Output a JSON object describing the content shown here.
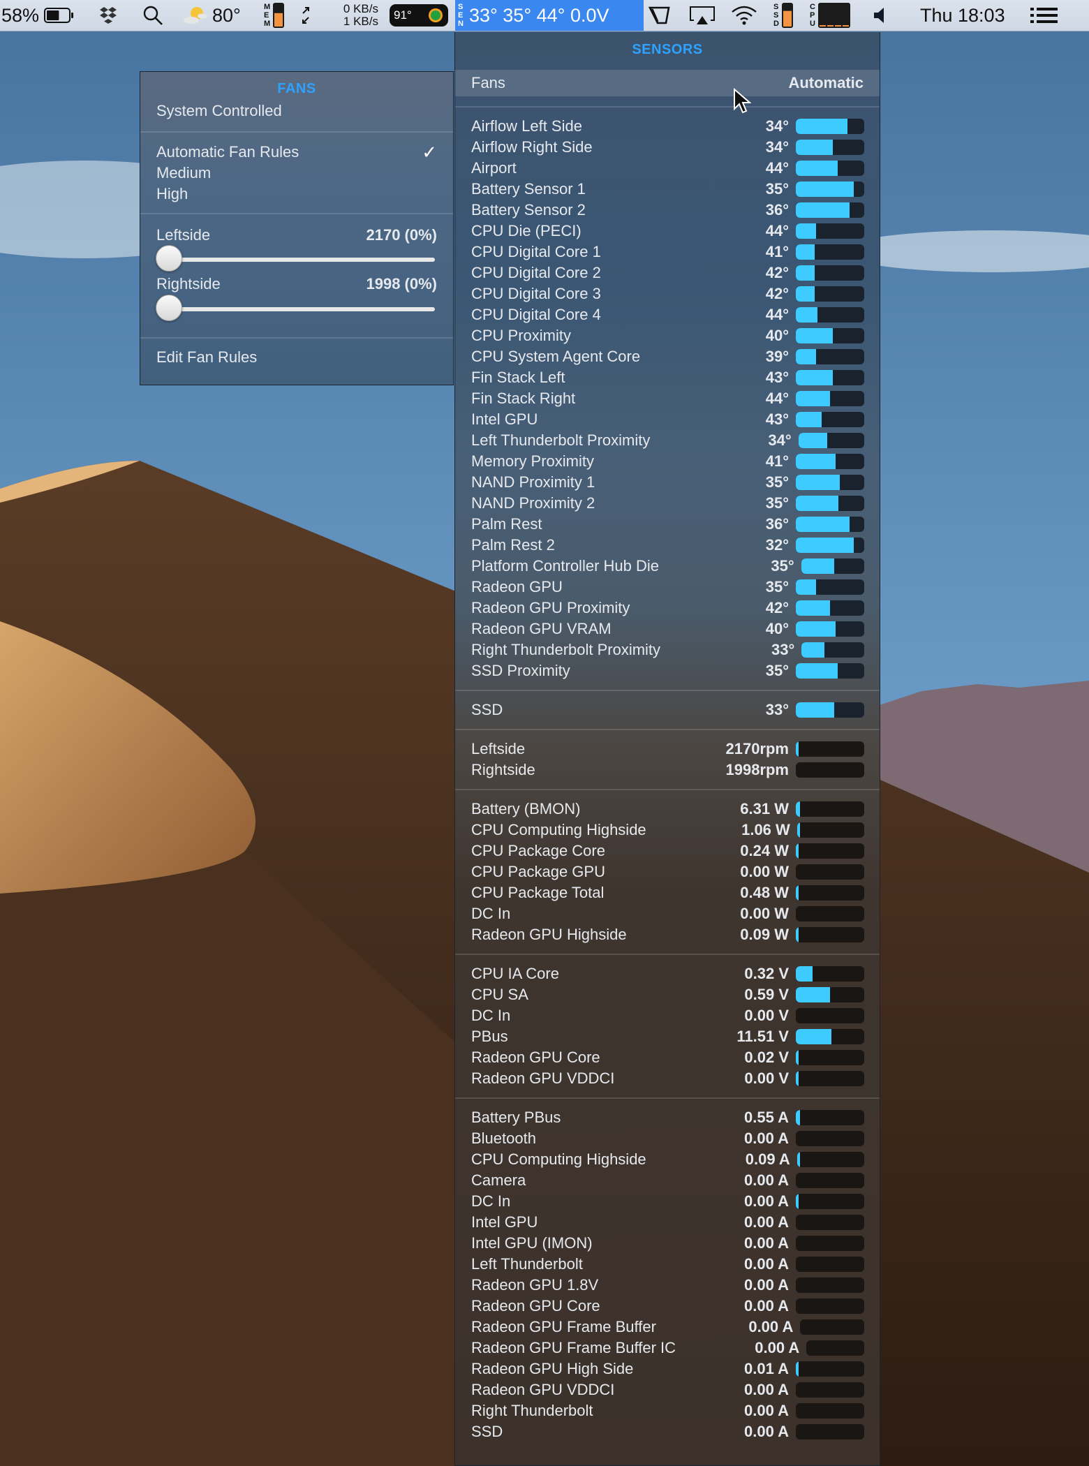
{
  "menubar": {
    "battery_percent": "58%",
    "battery_level": 0.58,
    "weather_temp": "80°",
    "mem_label": "MEM",
    "mem_level": 0.6,
    "net_up": "0 KB/s",
    "net_down": "1 KB/s",
    "cpu_temp_badge": "91°",
    "sen_label": "SEN",
    "sen_readings": "33° 35° 44° 0.0V",
    "ssd_label": "SSD",
    "ssd_level": 0.7,
    "cpu_label": "CPU",
    "clock": "Thu 18:03",
    "icons": [
      "battery-icon",
      "dropbox-icon",
      "search-icon",
      "weather-icon",
      "network-arrows-icon",
      "temperature-gauge-icon",
      "touch-bar-icon",
      "airplay-icon",
      "wifi-icon",
      "volume-icon",
      "notification-list-icon"
    ],
    "highlight_color": "#3b87f0"
  },
  "fans_menu": {
    "title": "FANS",
    "system_controlled": "System Controlled",
    "options": [
      {
        "label": "Automatic Fan Rules",
        "checked": true
      },
      {
        "label": "Medium",
        "checked": false
      },
      {
        "label": "High",
        "checked": false
      }
    ],
    "check_glyph": "✓",
    "fans": [
      {
        "label": "Leftside",
        "value": "2170 (0%)",
        "slider_fraction": 0.0
      },
      {
        "label": "Rightside",
        "value": "1998 (0%)",
        "slider_fraction": 0.0
      }
    ],
    "edit_rules": "Edit Fan Rules"
  },
  "sensors_menu": {
    "title": "SENSORS",
    "fans_header": {
      "label": "Fans",
      "value": "Automatic"
    },
    "accent_color": "#2da3ff",
    "bar_color": "#3ecbff",
    "groups": [
      {
        "kind": "temperature",
        "rows": [
          {
            "name": "Airflow Left Side",
            "value": "34°",
            "fill": 0.75
          },
          {
            "name": "Airflow Right Side",
            "value": "34°",
            "fill": 0.54
          },
          {
            "name": "Airport",
            "value": "44°",
            "fill": 0.61
          },
          {
            "name": "Battery Sensor 1",
            "value": "35°",
            "fill": 0.85
          },
          {
            "name": "Battery Sensor 2",
            "value": "36°",
            "fill": 0.79
          },
          {
            "name": "CPU Die (PECI)",
            "value": "44°",
            "fill": 0.3
          },
          {
            "name": "CPU Digital Core 1",
            "value": "41°",
            "fill": 0.28
          },
          {
            "name": "CPU Digital Core 2",
            "value": "42°",
            "fill": 0.28
          },
          {
            "name": "CPU Digital Core 3",
            "value": "42°",
            "fill": 0.28
          },
          {
            "name": "CPU Digital Core 4",
            "value": "44°",
            "fill": 0.32
          },
          {
            "name": "CPU Proximity",
            "value": "40°",
            "fill": 0.54
          },
          {
            "name": "CPU System Agent Core",
            "value": "39°",
            "fill": 0.3
          },
          {
            "name": "Fin Stack Left",
            "value": "43°",
            "fill": 0.54
          },
          {
            "name": "Fin Stack Right",
            "value": "44°",
            "fill": 0.5
          },
          {
            "name": "Intel GPU",
            "value": "43°",
            "fill": 0.38
          },
          {
            "name": "Left Thunderbolt Proximity",
            "value": "34°",
            "fill": 0.44
          },
          {
            "name": "Memory Proximity",
            "value": "41°",
            "fill": 0.58
          },
          {
            "name": "NAND Proximity 1",
            "value": "35°",
            "fill": 0.64
          },
          {
            "name": "NAND Proximity 2",
            "value": "35°",
            "fill": 0.62
          },
          {
            "name": "Palm Rest",
            "value": "36°",
            "fill": 0.79
          },
          {
            "name": "Palm Rest 2",
            "value": "32°",
            "fill": 0.85
          },
          {
            "name": "Platform Controller Hub Die",
            "value": "35°",
            "fill": 0.52
          },
          {
            "name": "Radeon GPU",
            "value": "35°",
            "fill": 0.3
          },
          {
            "name": "Radeon GPU Proximity",
            "value": "42°",
            "fill": 0.5
          },
          {
            "name": "Radeon GPU VRAM",
            "value": "40°",
            "fill": 0.58
          },
          {
            "name": "Right Thunderbolt Proximity",
            "value": "33°",
            "fill": 0.36
          },
          {
            "name": "SSD Proximity",
            "value": "35°",
            "fill": 0.61
          }
        ]
      },
      {
        "kind": "disk",
        "rows": [
          {
            "name": "SSD",
            "value": "33°",
            "fill": 0.56
          }
        ]
      },
      {
        "kind": "fan",
        "rows": [
          {
            "name": "Leftside",
            "value": "2170rpm",
            "fill": 0.02
          },
          {
            "name": "Rightside",
            "value": "1998rpm",
            "fill": 0.0
          }
        ]
      },
      {
        "kind": "power",
        "rows": [
          {
            "name": "Battery (BMON)",
            "value": "6.31 W",
            "fill": 0.06
          },
          {
            "name": "CPU Computing Highside",
            "value": "1.06 W",
            "fill": 0.02
          },
          {
            "name": "CPU Package Core",
            "value": "0.24 W",
            "fill": 0.02
          },
          {
            "name": "CPU Package GPU",
            "value": "0.00 W",
            "fill": 0.0
          },
          {
            "name": "CPU Package Total",
            "value": "0.48 W",
            "fill": 0.02
          },
          {
            "name": "DC In",
            "value": "0.00 W",
            "fill": 0.0
          },
          {
            "name": "Radeon GPU Highside",
            "value": "0.09 W",
            "fill": 0.02
          }
        ]
      },
      {
        "kind": "voltage",
        "rows": [
          {
            "name": "CPU IA Core",
            "value": "0.32 V",
            "fill": 0.24
          },
          {
            "name": "CPU SA",
            "value": "0.59 V",
            "fill": 0.5
          },
          {
            "name": "DC In",
            "value": "0.00 V",
            "fill": 0.0
          },
          {
            "name": "PBus",
            "value": "11.51 V",
            "fill": 0.52
          },
          {
            "name": "Radeon GPU Core",
            "value": "0.02 V",
            "fill": 0.02
          },
          {
            "name": "Radeon GPU VDDCI",
            "value": "0.00 V",
            "fill": 0.02
          }
        ]
      },
      {
        "kind": "current",
        "rows": [
          {
            "name": "Battery PBus",
            "value": "0.55 A",
            "fill": 0.06
          },
          {
            "name": "Bluetooth",
            "value": "0.00 A",
            "fill": 0.0
          },
          {
            "name": "CPU Computing Highside",
            "value": "0.09 A",
            "fill": 0.02
          },
          {
            "name": "Camera",
            "value": "0.00 A",
            "fill": 0.0
          },
          {
            "name": "DC In",
            "value": "0.00 A",
            "fill": 0.02
          },
          {
            "name": "Intel GPU",
            "value": "0.00 A",
            "fill": 0.0
          },
          {
            "name": "Intel GPU (IMON)",
            "value": "0.00 A",
            "fill": 0.0
          },
          {
            "name": "Left Thunderbolt",
            "value": "0.00 A",
            "fill": 0.0
          },
          {
            "name": "Radeon GPU 1.8V",
            "value": "0.00 A",
            "fill": 0.0
          },
          {
            "name": "Radeon GPU Core",
            "value": "0.00 A",
            "fill": 0.0
          },
          {
            "name": "Radeon GPU Frame Buffer",
            "value": "0.00 A",
            "fill": 0.0
          },
          {
            "name": "Radeon GPU Frame Buffer IC",
            "value": "0.00 A",
            "fill": 0.0
          },
          {
            "name": "Radeon GPU High Side",
            "value": "0.01 A",
            "fill": 0.02
          },
          {
            "name": "Radeon GPU VDDCI",
            "value": "0.00 A",
            "fill": 0.0
          },
          {
            "name": "Right Thunderbolt",
            "value": "0.00 A",
            "fill": 0.0
          },
          {
            "name": "SSD",
            "value": "0.00 A",
            "fill": 0.0
          }
        ]
      }
    ]
  }
}
